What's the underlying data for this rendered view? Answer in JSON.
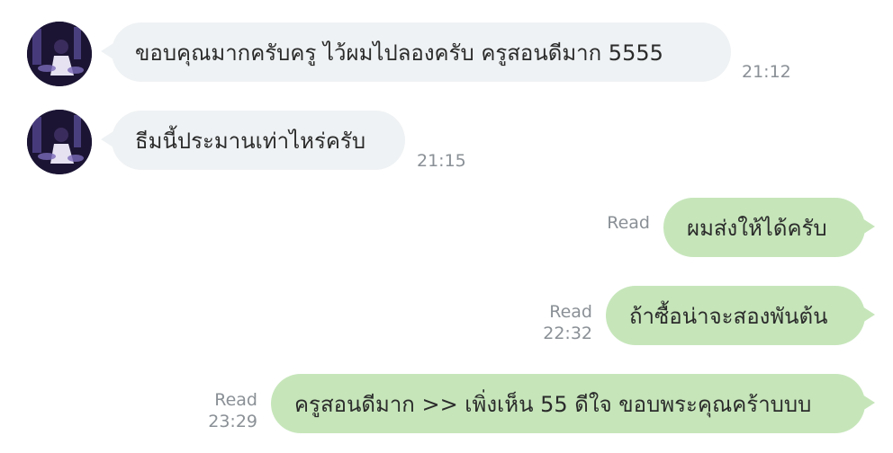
{
  "messages": [
    {
      "sender": "other",
      "text": "ขอบคุณมากครับครู ไว้ผมไปลองครับ ครูสอนดีมาก 5555",
      "time": "21:12"
    },
    {
      "sender": "other",
      "text": "ธีมนี้ประมานเท่าไหร่ครับ",
      "time": "21:15"
    },
    {
      "sender": "me",
      "text": "ผมส่งให้ได้ครับ",
      "status": "Read",
      "time": ""
    },
    {
      "sender": "me",
      "text": "ถ้าซื้อน่าจะสองพันต้น",
      "status": "Read",
      "time": "22:32"
    },
    {
      "sender": "me",
      "text": "ครูสอนดีมาก >> เพิ่งเห็น 55 ดีใจ ขอบพระคุณคร้าบบบ",
      "status": "Read",
      "time": "23:29"
    }
  ],
  "colors": {
    "incoming_bubble": "#eff2f4",
    "outgoing_bubble": "#c6e6ba",
    "meta_text": "#8a9096",
    "message_text": "#2b2b2b"
  },
  "icons": {
    "avatar": "avatar-photo"
  }
}
